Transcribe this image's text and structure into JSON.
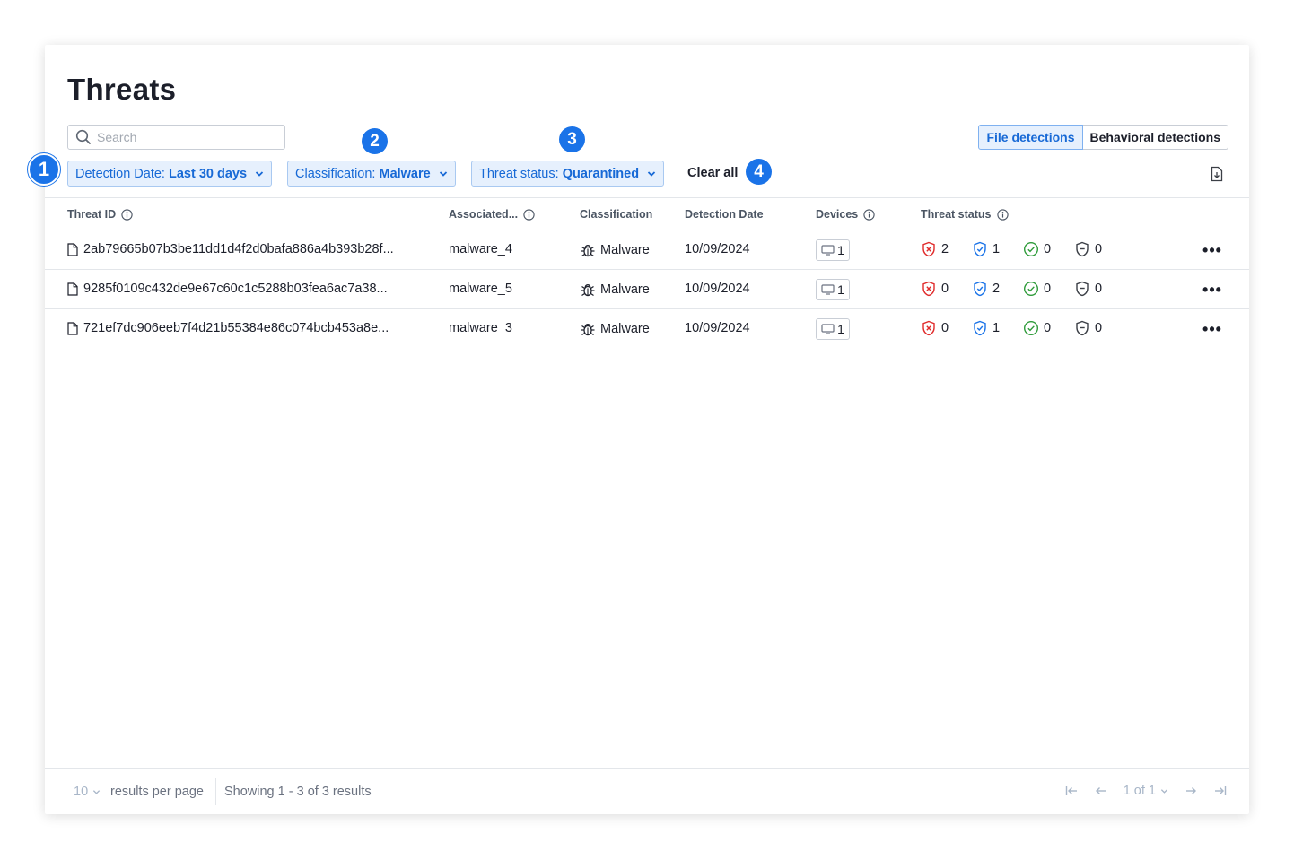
{
  "page": {
    "title": "Threats"
  },
  "search": {
    "placeholder": "Search"
  },
  "view_toggle": {
    "file_detections": "File detections",
    "behavioral_detections": "Behavioral detections"
  },
  "filters": [
    {
      "label": "Detection Date:",
      "value": "Last 30 days"
    },
    {
      "label": "Classification:",
      "value": "Malware"
    },
    {
      "label": "Threat status:",
      "value": "Quarantined"
    }
  ],
  "clear_all": "Clear all",
  "annotations": [
    "1",
    "2",
    "3",
    "4"
  ],
  "table": {
    "headers": [
      "Threat ID",
      "Associated...",
      "Classification",
      "Detection Date",
      "Devices",
      "Threat status"
    ],
    "rows": [
      {
        "threat_id": "2ab79665b07b3be11dd1d4f2d0bafa886a4b393b28f...",
        "associated": "malware_4",
        "classification": "Malware",
        "date": "10/09/2024",
        "devices": "1",
        "status": {
          "active": "2",
          "quarantined": "1",
          "resolved": "0",
          "other": "0"
        }
      },
      {
        "threat_id": "9285f0109c432de9e67c60c1c5288b03fea6ac7a38...",
        "associated": "malware_5",
        "classification": "Malware",
        "date": "10/09/2024",
        "devices": "1",
        "status": {
          "active": "0",
          "quarantined": "2",
          "resolved": "0",
          "other": "0"
        }
      },
      {
        "threat_id": "721ef7dc906eeb7f4d21b55384e86c074bcb453a8e...",
        "associated": "malware_3",
        "classification": "Malware",
        "date": "10/09/2024",
        "devices": "1",
        "status": {
          "active": "0",
          "quarantined": "1",
          "resolved": "0",
          "other": "0"
        }
      }
    ]
  },
  "footer": {
    "per_page": "10",
    "per_page_label": "results per page",
    "showing": "Showing 1 - 3 of 3 results",
    "page_indicator": "1 of 1"
  },
  "colors": {
    "accent": "#1a73e8",
    "active_threat": "#e02b2b",
    "quarantined": "#1a73e8",
    "resolved": "#2e9b3a",
    "neutral": "#3b3f46"
  },
  "icons": [
    "search-icon",
    "chevron-down-icon",
    "export-icon",
    "info-icon",
    "file-icon",
    "bug-icon",
    "monitor-icon",
    "shield-x-icon",
    "shield-check-icon",
    "check-circle-icon",
    "shield-minus-icon",
    "more-icon",
    "first-page-icon",
    "prev-page-icon",
    "next-page-icon",
    "last-page-icon"
  ]
}
